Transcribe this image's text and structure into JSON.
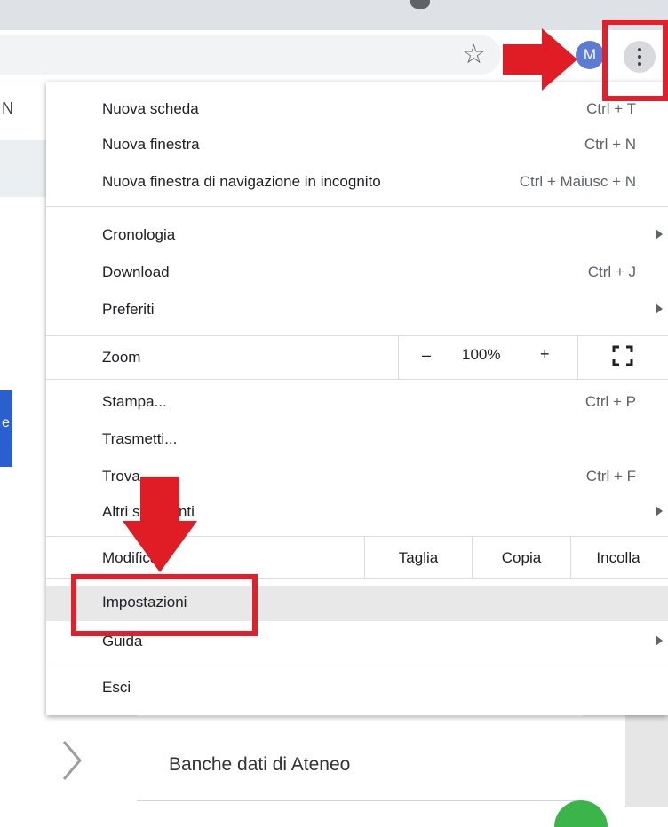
{
  "browser": {
    "avatar_letter": "M",
    "icons": [
      "star-icon",
      "kebab-menu-icon"
    ]
  },
  "background": {
    "left_letter": "N",
    "blue_tab_letter": "e",
    "link_text": "Banche dati di Ateneo"
  },
  "menu": {
    "group1": [
      {
        "label": "Nuova scheda",
        "shortcut": "Ctrl + T"
      },
      {
        "label": "Nuova finestra",
        "shortcut": "Ctrl + N"
      },
      {
        "label": "Nuova finestra di navigazione in incognito",
        "shortcut": "Ctrl + Maiusc + N"
      }
    ],
    "group2": [
      {
        "label": "Cronologia",
        "submenu": true
      },
      {
        "label": "Download",
        "shortcut": "Ctrl + J"
      },
      {
        "label": "Preferiti",
        "submenu": true
      }
    ],
    "zoom": {
      "label": "Zoom",
      "minus": "–",
      "value": "100%",
      "plus": "+"
    },
    "group3": [
      {
        "label": "Stampa...",
        "shortcut": "Ctrl + P"
      },
      {
        "label": "Trasmetti..."
      },
      {
        "label": "Trova...",
        "shortcut": "Ctrl + F"
      },
      {
        "label": "Altri strumenti",
        "submenu": true
      }
    ],
    "edit": {
      "label": "Modifica",
      "cut": "Taglia",
      "copy": "Copia",
      "paste": "Incolla"
    },
    "group4": [
      {
        "label": "Impostazioni"
      },
      {
        "label": "Guida",
        "submenu": true
      }
    ],
    "exit": {
      "label": "Esci"
    }
  },
  "annotations": {
    "highlight_color": "#e0202a",
    "arrow_color": "#e01d25"
  }
}
